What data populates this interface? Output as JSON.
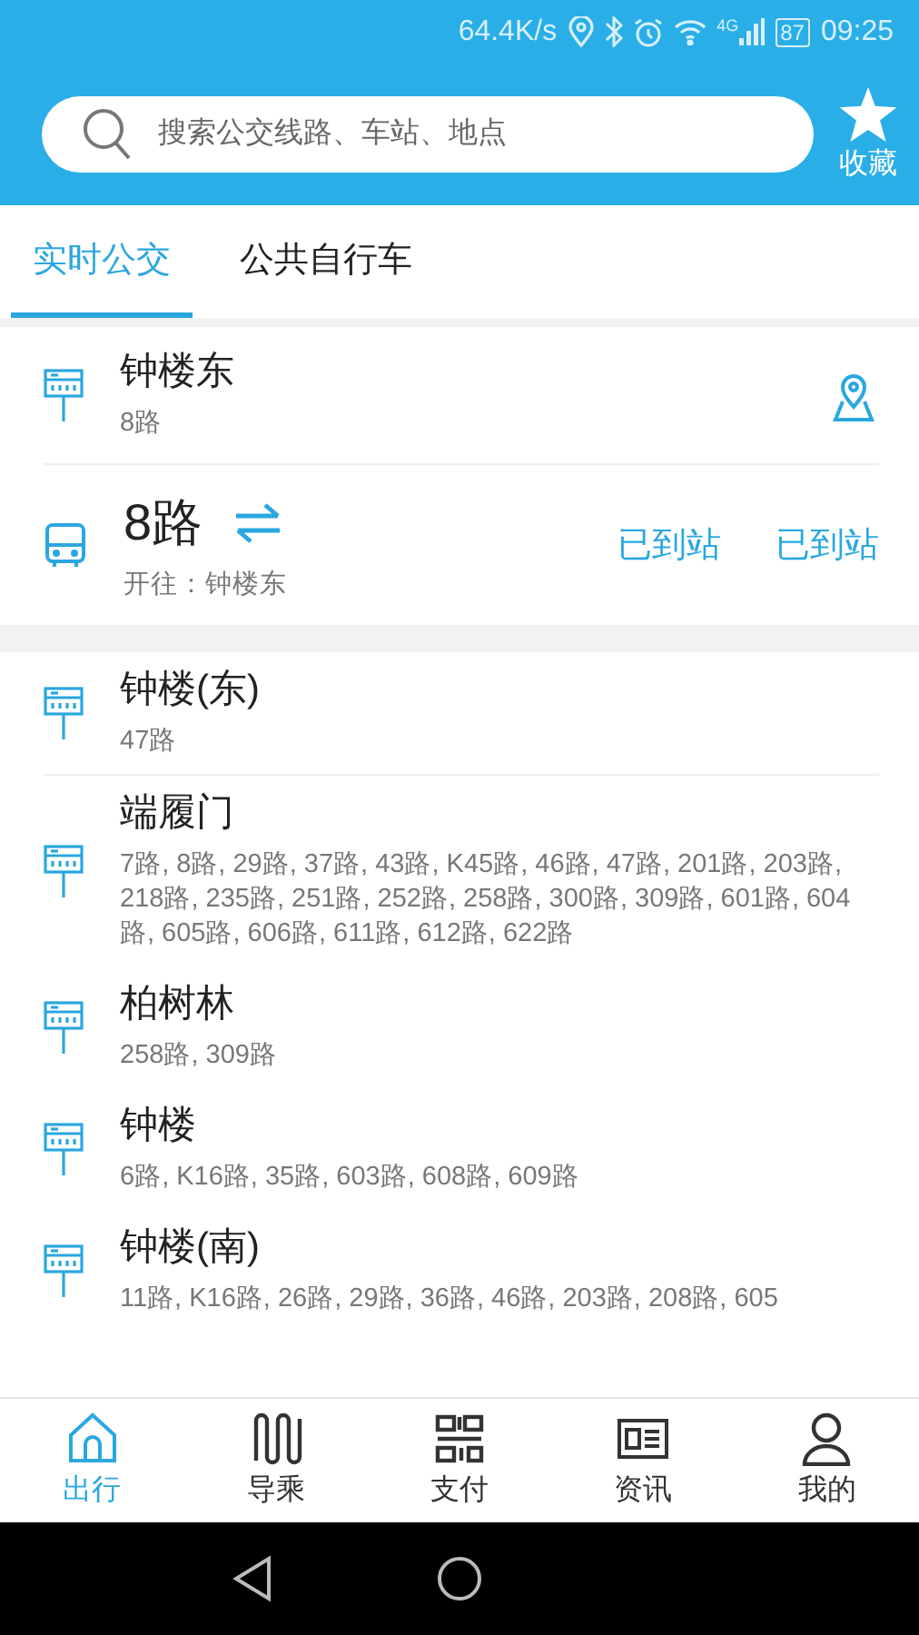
{
  "status_bar": {
    "speed": "64.4K/s",
    "network": "4G",
    "battery": "87",
    "time": "09:25"
  },
  "header": {
    "search": {
      "placeholder": "搜索公交线路、车站、地点"
    },
    "favorites": "收藏"
  },
  "tabs": [
    {
      "label": "实时公交",
      "selected": true
    },
    {
      "label": "公共自行车",
      "selected": false
    }
  ],
  "nearby": {
    "stop": "钟楼东",
    "routes": "8路",
    "bus": {
      "route": "8路",
      "direction": "开往：钟楼东",
      "arrivals": [
        "已到站",
        "已到站"
      ]
    }
  },
  "stops": [
    {
      "name": "钟楼(东)",
      "routes": "47路"
    },
    {
      "name": "端履门",
      "routes": "7路, 8路, 29路, 37路, 43路, K45路, 46路, 47路, 201路, 203路, 218路, 235路, 251路, 252路, 258路, 300路, 309路, 601路, 604路, 605路, 606路, 611路, 612路, 622路"
    },
    {
      "name": "柏树林",
      "routes": "258路, 309路"
    },
    {
      "name": "钟楼",
      "routes": "6路, K16路, 35路, 603路, 608路, 609路"
    },
    {
      "name": "钟楼(南)",
      "routes": "11路, K16路, 26路, 29路, 36路, 46路, 203路, 208路, 605"
    }
  ],
  "bottom_nav": [
    {
      "label": "出行",
      "selected": true
    },
    {
      "label": "导乘",
      "selected": false
    },
    {
      "label": "支付",
      "selected": false
    },
    {
      "label": "资讯",
      "selected": false
    },
    {
      "label": "我的",
      "selected": false
    }
  ]
}
